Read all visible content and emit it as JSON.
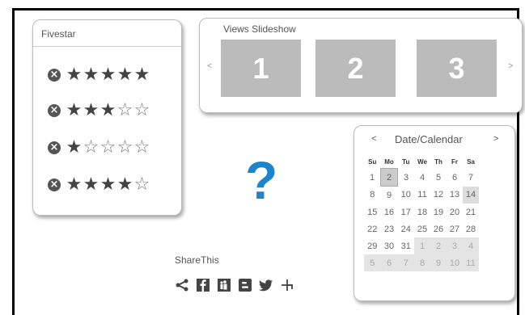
{
  "fivestar": {
    "title": "Fivestar",
    "ratings": [
      {
        "stars": 5,
        "max": 5
      },
      {
        "stars": 3,
        "max": 5
      },
      {
        "stars": 1,
        "max": 5
      },
      {
        "stars": 4,
        "max": 5
      }
    ]
  },
  "slideshow": {
    "title": "Views Slideshow",
    "prev": "<",
    "next": ">",
    "slides": [
      "1",
      "2",
      "3"
    ]
  },
  "calendar": {
    "title": "Date/Calendar",
    "prev": "<",
    "next": ">",
    "weekdays": [
      "Su",
      "Mo",
      "Tu",
      "We",
      "Th",
      "Fr",
      "Sa"
    ],
    "weeks": [
      [
        "1",
        "2",
        "3",
        "4",
        "5",
        "6",
        "7"
      ],
      [
        "8",
        "9",
        "10",
        "11",
        "12",
        "13",
        "14"
      ],
      [
        "15",
        "16",
        "17",
        "18",
        "19",
        "20",
        "21"
      ],
      [
        "22",
        "23",
        "24",
        "25",
        "26",
        "27",
        "28"
      ],
      [
        "29",
        "30",
        "31",
        "1",
        "2",
        "3",
        "4"
      ],
      [
        "5",
        "6",
        "7",
        "8",
        "9",
        "10",
        "11"
      ]
    ],
    "selected_day": "2",
    "highlighted_day": "14"
  },
  "placeholder": {
    "symbol": "?"
  },
  "share": {
    "label": "ShareThis",
    "icons": [
      "share-icon",
      "facebook-icon",
      "myspace-icon",
      "blogger-icon",
      "twitter-icon",
      "delicious-icon"
    ]
  },
  "colors": {
    "accent": "#1f85c9",
    "slide_bg": "#bbbbbb"
  }
}
